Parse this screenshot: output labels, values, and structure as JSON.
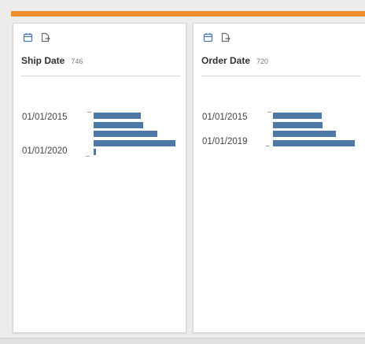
{
  "accent_color": "#f28e2b",
  "bar_color": "#4e79a7",
  "cards": [
    {
      "field_icon": "calendar-icon",
      "menu_icon": "field-options-icon",
      "title": "Ship Date",
      "count": "746",
      "tick_top": "01/01/2015",
      "tick_bottom": "01/01/2020",
      "bar_fractions": [
        0.58,
        0.61,
        0.78,
        1.0,
        0.03
      ]
    },
    {
      "field_icon": "calendar-icon",
      "menu_icon": "field-options-icon",
      "title": "Order Date",
      "count": "720",
      "tick_top": "01/01/2015",
      "tick_bottom": "01/01/2019",
      "bar_fractions": [
        0.6,
        0.61,
        0.77,
        1.0
      ]
    }
  ]
}
